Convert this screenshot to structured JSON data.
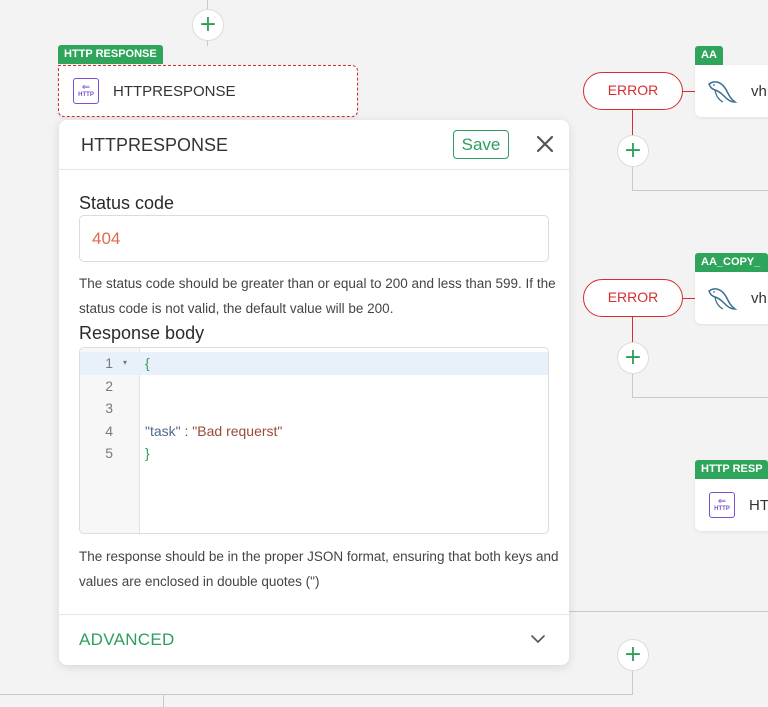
{
  "canvas": {
    "left_node": {
      "tag": "HTTP RESPONSE",
      "label": "HTTPRESPONSE",
      "icon": "http-response-icon"
    },
    "right_nodes": [
      {
        "tag": "AA",
        "label": "vh",
        "icon": "mysql-dolphin-icon",
        "error_label": "ERROR"
      },
      {
        "tag": "AA_COPY_",
        "label": "vh",
        "icon": "mysql-dolphin-icon",
        "error_label": "ERROR"
      },
      {
        "tag": "HTTP RESP",
        "label": "HT",
        "icon": "http-response-icon"
      }
    ],
    "plus_symbol": "+",
    "http_icon_text": "HTTP",
    "http_icon_arrow": "⇐"
  },
  "panel": {
    "title": "HTTPRESPONSE",
    "save_label": "Save",
    "status_code": {
      "label": "Status code",
      "value": "404",
      "helper": "The status code should be greater than or equal to 200 and less than 599. If the status code is not valid, the default value will be 200."
    },
    "response_body": {
      "label": "Response body",
      "lines": [
        {
          "num": "1",
          "text": "{"
        },
        {
          "num": "2",
          "text": ""
        },
        {
          "num": "3",
          "text": ""
        },
        {
          "num": "4",
          "text": "\"task\" : \"Bad requerst\""
        },
        {
          "num": "5",
          "text": "}"
        }
      ],
      "fold_marker": "▾",
      "helper": "The response should be in the proper JSON format, ensuring that both keys and values are enclosed in double quotes (\")"
    },
    "advanced_label": "ADVANCED"
  },
  "colors": {
    "accent_green": "#2e9e5b",
    "tag_green": "#2ea55a",
    "error_red": "#d32f2f",
    "status_value": "#e06a4f",
    "http_icon_purple": "#7b4fcf"
  }
}
